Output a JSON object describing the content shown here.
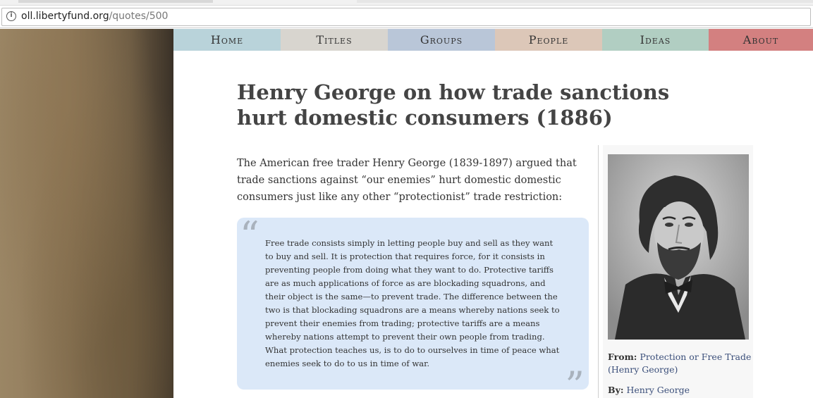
{
  "browser": {
    "url_host": "oll.libertyfund.org",
    "url_path": "/quotes/500"
  },
  "nav": {
    "items": [
      {
        "label": "Home",
        "color": "#b9d3da"
      },
      {
        "label": "Titles",
        "color": "#d8d5cf"
      },
      {
        "label": "Groups",
        "color": "#b9c6d8"
      },
      {
        "label": "People",
        "color": "#dcc7b8"
      },
      {
        "label": "Ideas",
        "color": "#b1cec2"
      },
      {
        "label": "About",
        "color": "#d38080"
      }
    ]
  },
  "page": {
    "title": "Henry George on how trade sanctions hurt domestic consumers (1886)",
    "intro": "The American free trader Henry George (1839-1897) argued that trade sanctions against “our enemies” hurt domestic domestic consumers just like any other “protectionist” trade restriction:",
    "quote": "Free trade consists simply in letting people buy and sell as they want to buy and sell. It is protection that requires force, for it consists in preventing people from doing what they want to do. Protective tariffs are as much applications of force as are blockading squadrons, and their object is the same—to prevent trade. The difference between the two is that blockading squadrons are a means whereby nations seek to prevent their enemies from trading; protective tariffs are a means whereby nations attempt to prevent their own people from trading. What protection teaches us, is to do to ourselves in time of peace what enemies seek to do to us in time of war.",
    "quote_open": "“",
    "quote_close": "”"
  },
  "sidebar": {
    "from_label": "From:",
    "from_link": "Protection or Free Trade (Henry George)",
    "by_label": "By:",
    "by_link": "Henry George"
  }
}
